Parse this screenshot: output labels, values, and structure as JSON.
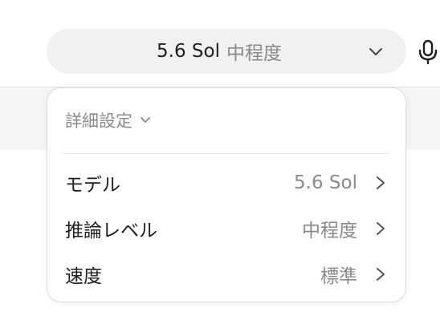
{
  "selector": {
    "model": "5.6 Sol",
    "level": "中程度"
  },
  "panel": {
    "header": "詳細設定",
    "rows": [
      {
        "label": "モデル",
        "value": "5.6 Sol"
      },
      {
        "label": "推論レベル",
        "value": "中程度"
      },
      {
        "label": "速度",
        "value": "標準"
      }
    ]
  },
  "icons": {
    "selector_chevron": "chevron-down-icon",
    "mic": "microphone-icon",
    "header_chevron": "chevron-down-icon",
    "row_chevron": "chevron-right-icon"
  },
  "colors": {
    "primary_text": "#1f1f1f",
    "secondary_text": "#8a8a8a",
    "selector_bg": "#f1f1f1"
  }
}
